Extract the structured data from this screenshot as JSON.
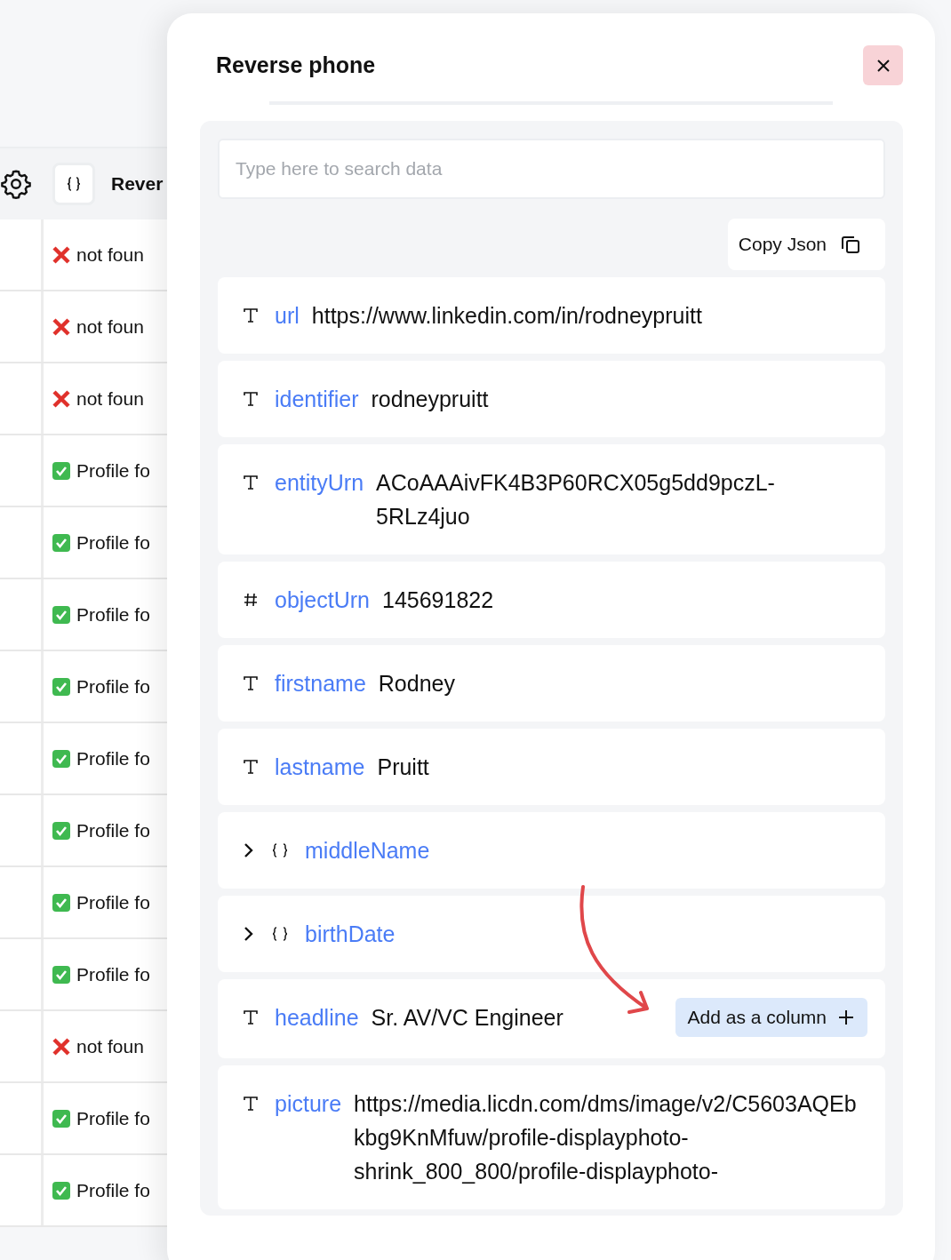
{
  "table": {
    "header": {
      "title": "Rever"
    },
    "rows": [
      {
        "kind": "missing",
        "text": "not foun"
      },
      {
        "kind": "missing",
        "text": "not foun"
      },
      {
        "kind": "missing",
        "text": "not foun"
      },
      {
        "kind": "found",
        "text": "Profile fo"
      },
      {
        "kind": "found",
        "text": "Profile fo"
      },
      {
        "kind": "found",
        "text": "Profile fo"
      },
      {
        "kind": "found",
        "text": "Profile fo"
      },
      {
        "kind": "found",
        "text": "Profile fo"
      },
      {
        "kind": "found",
        "text": "Profile fo"
      },
      {
        "kind": "found",
        "text": "Profile fo"
      },
      {
        "kind": "found",
        "text": "Profile fo"
      },
      {
        "kind": "missing",
        "text": "not foun"
      },
      {
        "kind": "found",
        "text": "Profile fo"
      },
      {
        "kind": "found",
        "text": "Profile fo"
      }
    ]
  },
  "modal": {
    "title": "Reverse phone",
    "search": {
      "placeholder": "Type here to search data"
    },
    "copy_button": "Copy Json",
    "fields": [
      {
        "kind": "text",
        "key": "url",
        "value": "https://www.linkedin.com/in/rodneypruitt"
      },
      {
        "kind": "text",
        "key": "identifier",
        "value": "rodneypruitt"
      },
      {
        "kind": "text",
        "key": "entityUrn",
        "value": "ACoAAAivFK4B3P60RCX05g5dd9pczL-5RLz4juo"
      },
      {
        "kind": "number",
        "key": "objectUrn",
        "value": "145691822"
      },
      {
        "kind": "text",
        "key": "firstname",
        "value": "Rodney"
      },
      {
        "kind": "text",
        "key": "lastname",
        "value": "Pruitt"
      },
      {
        "kind": "object",
        "key": "middleName",
        "expanded": false
      },
      {
        "kind": "object",
        "key": "birthDate",
        "expanded": false
      },
      {
        "kind": "text",
        "key": "headline",
        "value": "Sr. AV/VC Engineer",
        "action": "Add as a column"
      },
      {
        "kind": "text",
        "key": "picture",
        "value": "https://media.licdn.com/dms/image/v2/C5603AQEbkbg9KnMfuw/profile-displayphoto-shrink_800_800/profile-displayphoto-"
      }
    ]
  }
}
